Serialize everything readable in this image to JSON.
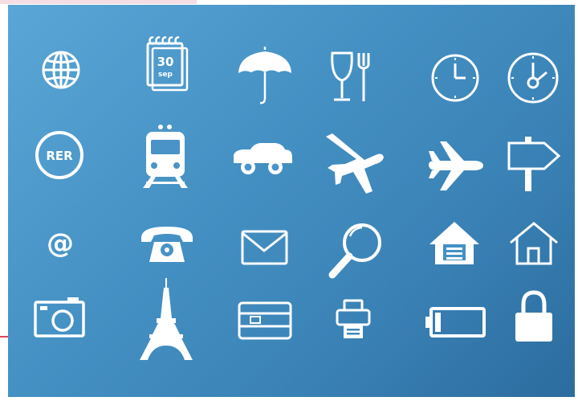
{
  "colors": {
    "panel_light": "#5aa6d6",
    "panel_dark": "#2c6c9e",
    "icon": "#ffffff",
    "accent_line": "#e0455a"
  },
  "icons": {
    "row1": [
      "globe-icon",
      "calendar-icon",
      "umbrella-icon",
      "restaurant-icon",
      "clock-icon",
      "clock-alarm-icon"
    ],
    "row2": [
      "rer-train-badge-icon",
      "train-icon",
      "car-icon",
      "airplane-takeoff-icon",
      "airplane-icon",
      "signpost-icon"
    ],
    "row3": [
      "at-sign-icon",
      "telephone-icon",
      "envelope-icon",
      "magnifier-icon",
      "house-garage-icon",
      "house-icon"
    ],
    "row4": [
      "camera-icon",
      "eiffel-tower-icon",
      "credit-card-icon",
      "fax-printer-icon",
      "battery-icon",
      "padlock-icon"
    ]
  },
  "labels": {
    "calendar_number": "30",
    "calendar_sub": "sep",
    "rer": "RER",
    "at": "@"
  }
}
